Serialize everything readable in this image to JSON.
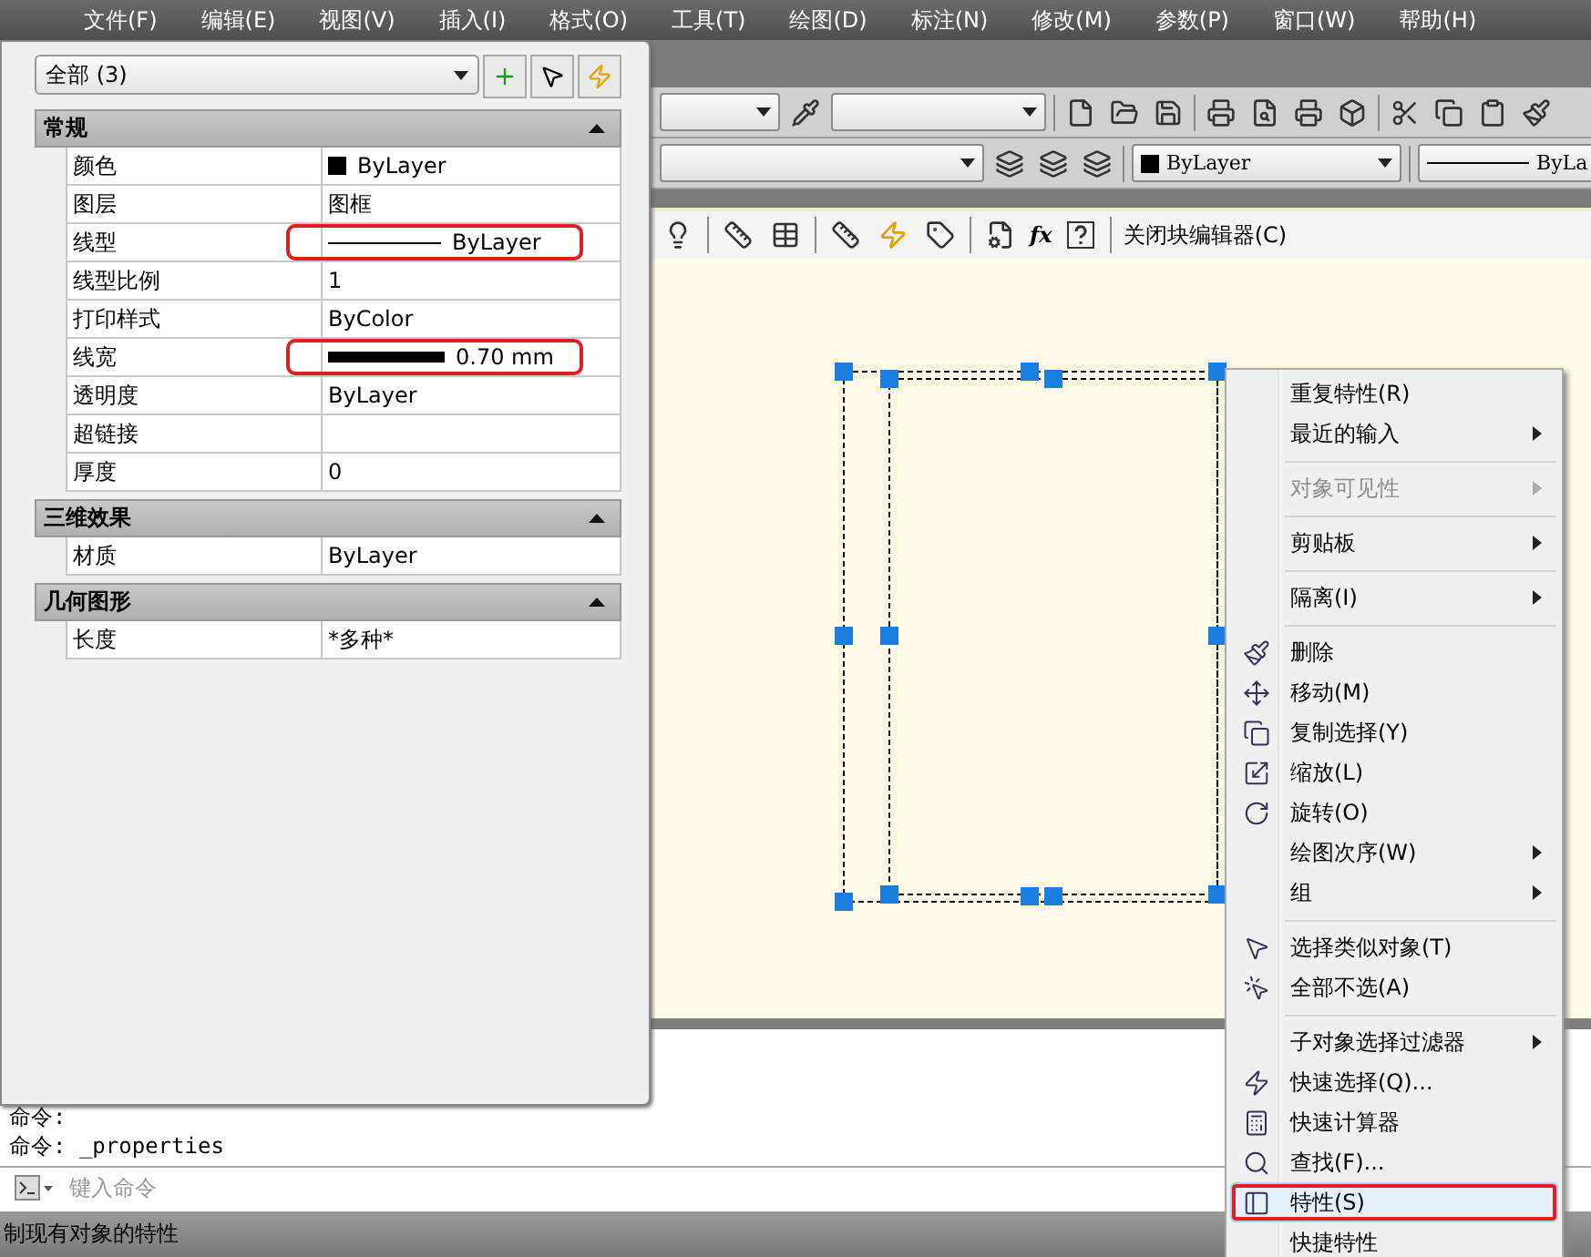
{
  "menu_bar": {
    "items": [
      "文件(F)",
      "编辑(E)",
      "视图(V)",
      "插入(I)",
      "格式(O)",
      "工具(T)",
      "绘图(D)",
      "标注(N)",
      "修改(M)",
      "参数(P)",
      "窗口(W)",
      "帮助(H)"
    ]
  },
  "toolbars": {
    "color_dropdown": "ByLayer",
    "linetype_dropdown": "ByLa",
    "close_block_editor": "关闭块编辑器(C)",
    "fx_label": "fx"
  },
  "properties_palette": {
    "selection": "全部 (3)",
    "sections": [
      {
        "title": "常规",
        "expanded": true,
        "rows": [
          {
            "label": "颜色",
            "value": "ByLayer",
            "kind": "color",
            "highlighted": false
          },
          {
            "label": "图层",
            "value": "图框",
            "kind": "text",
            "highlighted": false
          },
          {
            "label": "线型",
            "value": "ByLayer",
            "kind": "linetype",
            "highlighted": true
          },
          {
            "label": "线型比例",
            "value": "1",
            "kind": "text",
            "highlighted": false
          },
          {
            "label": "打印样式",
            "value": "ByColor",
            "kind": "text",
            "highlighted": false
          },
          {
            "label": "线宽",
            "value": "0.70 mm",
            "kind": "lineweight",
            "highlighted": true
          },
          {
            "label": "透明度",
            "value": "ByLayer",
            "kind": "text",
            "highlighted": false
          },
          {
            "label": "超链接",
            "value": "",
            "kind": "text",
            "highlighted": false
          },
          {
            "label": "厚度",
            "value": "0",
            "kind": "text",
            "highlighted": false
          }
        ]
      },
      {
        "title": "三维效果",
        "expanded": true,
        "rows": [
          {
            "label": "材质",
            "value": "ByLayer",
            "kind": "text",
            "highlighted": false
          }
        ]
      },
      {
        "title": "几何图形",
        "expanded": true,
        "rows": [
          {
            "label": "长度",
            "value": "*多种*",
            "kind": "text",
            "highlighted": false
          }
        ]
      }
    ]
  },
  "context_menu": {
    "items": [
      {
        "kind": "item",
        "label": "重复特性(R)",
        "submenu": false,
        "disabled": false,
        "selected": false,
        "highlighted": false
      },
      {
        "kind": "item",
        "label": "最近的输入",
        "submenu": true,
        "disabled": false,
        "selected": false,
        "highlighted": false
      },
      {
        "kind": "separator"
      },
      {
        "kind": "item",
        "label": "对象可见性",
        "submenu": true,
        "disabled": true,
        "selected": false,
        "highlighted": false
      },
      {
        "kind": "separator"
      },
      {
        "kind": "item",
        "label": "剪贴板",
        "submenu": true,
        "disabled": false,
        "selected": false,
        "highlighted": false
      },
      {
        "kind": "separator"
      },
      {
        "kind": "item",
        "label": "隔离(I)",
        "submenu": true,
        "disabled": false,
        "selected": false,
        "highlighted": false
      },
      {
        "kind": "separator"
      },
      {
        "kind": "item",
        "label": "删除",
        "submenu": false,
        "disabled": false,
        "selected": false,
        "highlighted": false
      },
      {
        "kind": "item",
        "label": "移动(M)",
        "submenu": false,
        "disabled": false,
        "selected": false,
        "highlighted": false
      },
      {
        "kind": "item",
        "label": "复制选择(Y)",
        "submenu": false,
        "disabled": false,
        "selected": false,
        "highlighted": false
      },
      {
        "kind": "item",
        "label": "缩放(L)",
        "submenu": false,
        "disabled": false,
        "selected": false,
        "highlighted": false
      },
      {
        "kind": "item",
        "label": "旋转(O)",
        "submenu": false,
        "disabled": false,
        "selected": false,
        "highlighted": false
      },
      {
        "kind": "item",
        "label": "绘图次序(W)",
        "submenu": true,
        "disabled": false,
        "selected": false,
        "highlighted": false
      },
      {
        "kind": "item",
        "label": "组",
        "submenu": true,
        "disabled": false,
        "selected": false,
        "highlighted": false
      },
      {
        "kind": "separator"
      },
      {
        "kind": "item",
        "label": "选择类似对象(T)",
        "submenu": false,
        "disabled": false,
        "selected": false,
        "highlighted": false
      },
      {
        "kind": "item",
        "label": "全部不选(A)",
        "submenu": false,
        "disabled": false,
        "selected": false,
        "highlighted": false
      },
      {
        "kind": "separator"
      },
      {
        "kind": "item",
        "label": "子对象选择过滤器",
        "submenu": true,
        "disabled": false,
        "selected": false,
        "highlighted": false
      },
      {
        "kind": "item",
        "label": "快速选择(Q)...",
        "submenu": false,
        "disabled": false,
        "selected": false,
        "highlighted": false
      },
      {
        "kind": "item",
        "label": "快速计算器",
        "submenu": false,
        "disabled": false,
        "selected": false,
        "highlighted": false
      },
      {
        "kind": "item",
        "label": "查找(F)...",
        "submenu": false,
        "disabled": false,
        "selected": false,
        "highlighted": false
      },
      {
        "kind": "item",
        "label": "特性(S)",
        "submenu": false,
        "disabled": false,
        "selected": true,
        "highlighted": true
      },
      {
        "kind": "item",
        "label": "快捷特性",
        "submenu": false,
        "disabled": false,
        "selected": false,
        "highlighted": false
      }
    ]
  },
  "command_line": {
    "history": [
      "命令:",
      "命令: _properties"
    ],
    "placeholder": "键入命令"
  },
  "status_bar": {
    "text": "制现有对象的特性"
  }
}
